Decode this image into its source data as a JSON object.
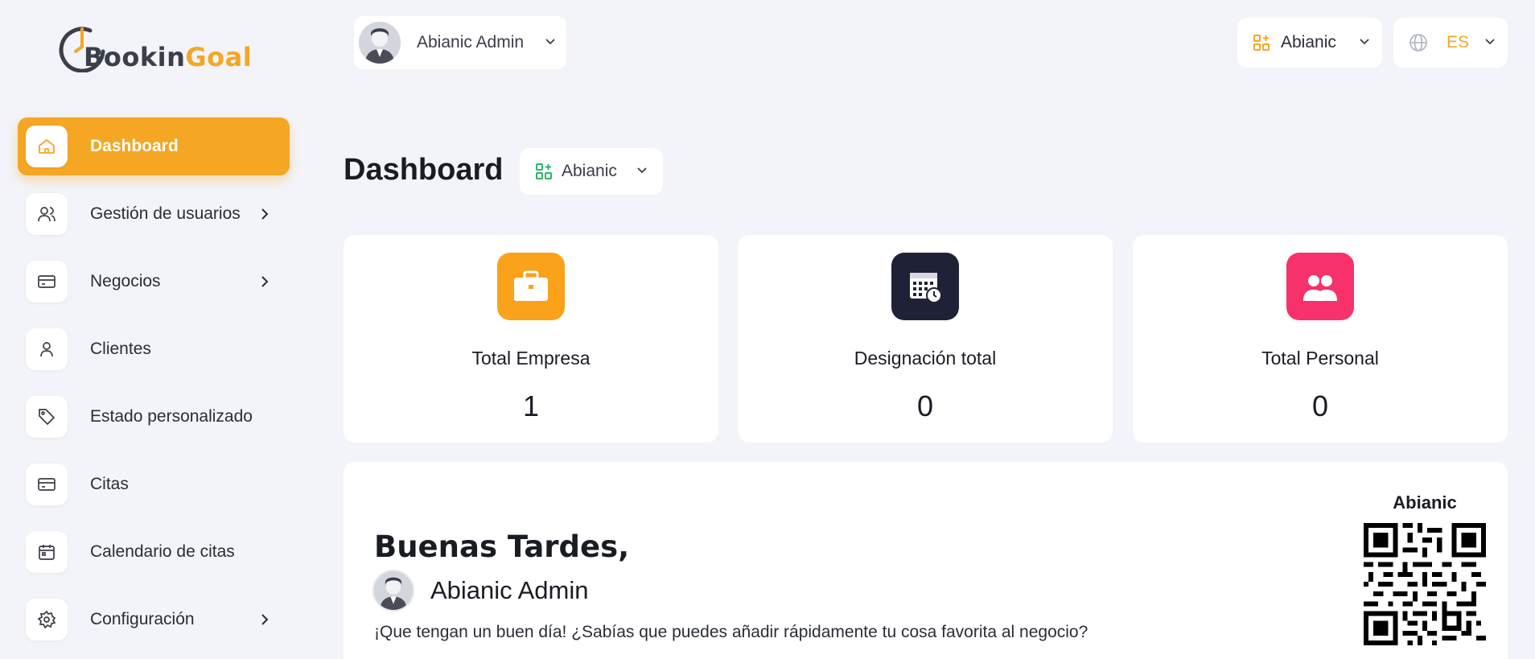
{
  "logo": {
    "part1": "Bookin",
    "part2": "Goal"
  },
  "sidebar": {
    "items": [
      {
        "label": "Dashboard",
        "icon": "home-icon",
        "active": true,
        "arrow": false
      },
      {
        "label": "Gestión de usuarios",
        "icon": "users-icon",
        "active": false,
        "arrow": true
      },
      {
        "label": "Negocios",
        "icon": "card-icon",
        "active": false,
        "arrow": true
      },
      {
        "label": "Clientes",
        "icon": "user-icon",
        "active": false,
        "arrow": false
      },
      {
        "label": "Estado personalizado",
        "icon": "tag-icon",
        "active": false,
        "arrow": false
      },
      {
        "label": "Citas",
        "icon": "card-icon",
        "active": false,
        "arrow": false
      },
      {
        "label": "Calendario de citas",
        "icon": "calendar-icon",
        "active": false,
        "arrow": false
      },
      {
        "label": "Configuración",
        "icon": "gear-icon",
        "active": false,
        "arrow": true
      }
    ]
  },
  "topbar": {
    "user_name": "Abianic Admin",
    "business": "Abianic",
    "language": "ES"
  },
  "page": {
    "title": "Dashboard",
    "business_selector": "Abianic"
  },
  "stats": [
    {
      "title": "Total Empresa",
      "value": "1",
      "icon": "briefcase-icon",
      "color": "#f9a21a"
    },
    {
      "title": "Designación total",
      "value": "0",
      "icon": "calendar-clock-icon",
      "color": "#1f2236"
    },
    {
      "title": "Total Personal",
      "value": "0",
      "icon": "staff-icon",
      "color": "#f7316b"
    }
  ],
  "welcome": {
    "greeting": "Buenas Tardes,",
    "user_name": "Abianic Admin",
    "message": "¡Que tengan un buen día! ¿Sabías que puedes añadir rápidamente tu cosa favorita al negocio?",
    "qr_title": "Abianic"
  },
  "colors": {
    "accent": "#f5a623",
    "background": "#f3f4f9",
    "green": "#2fb36b"
  }
}
